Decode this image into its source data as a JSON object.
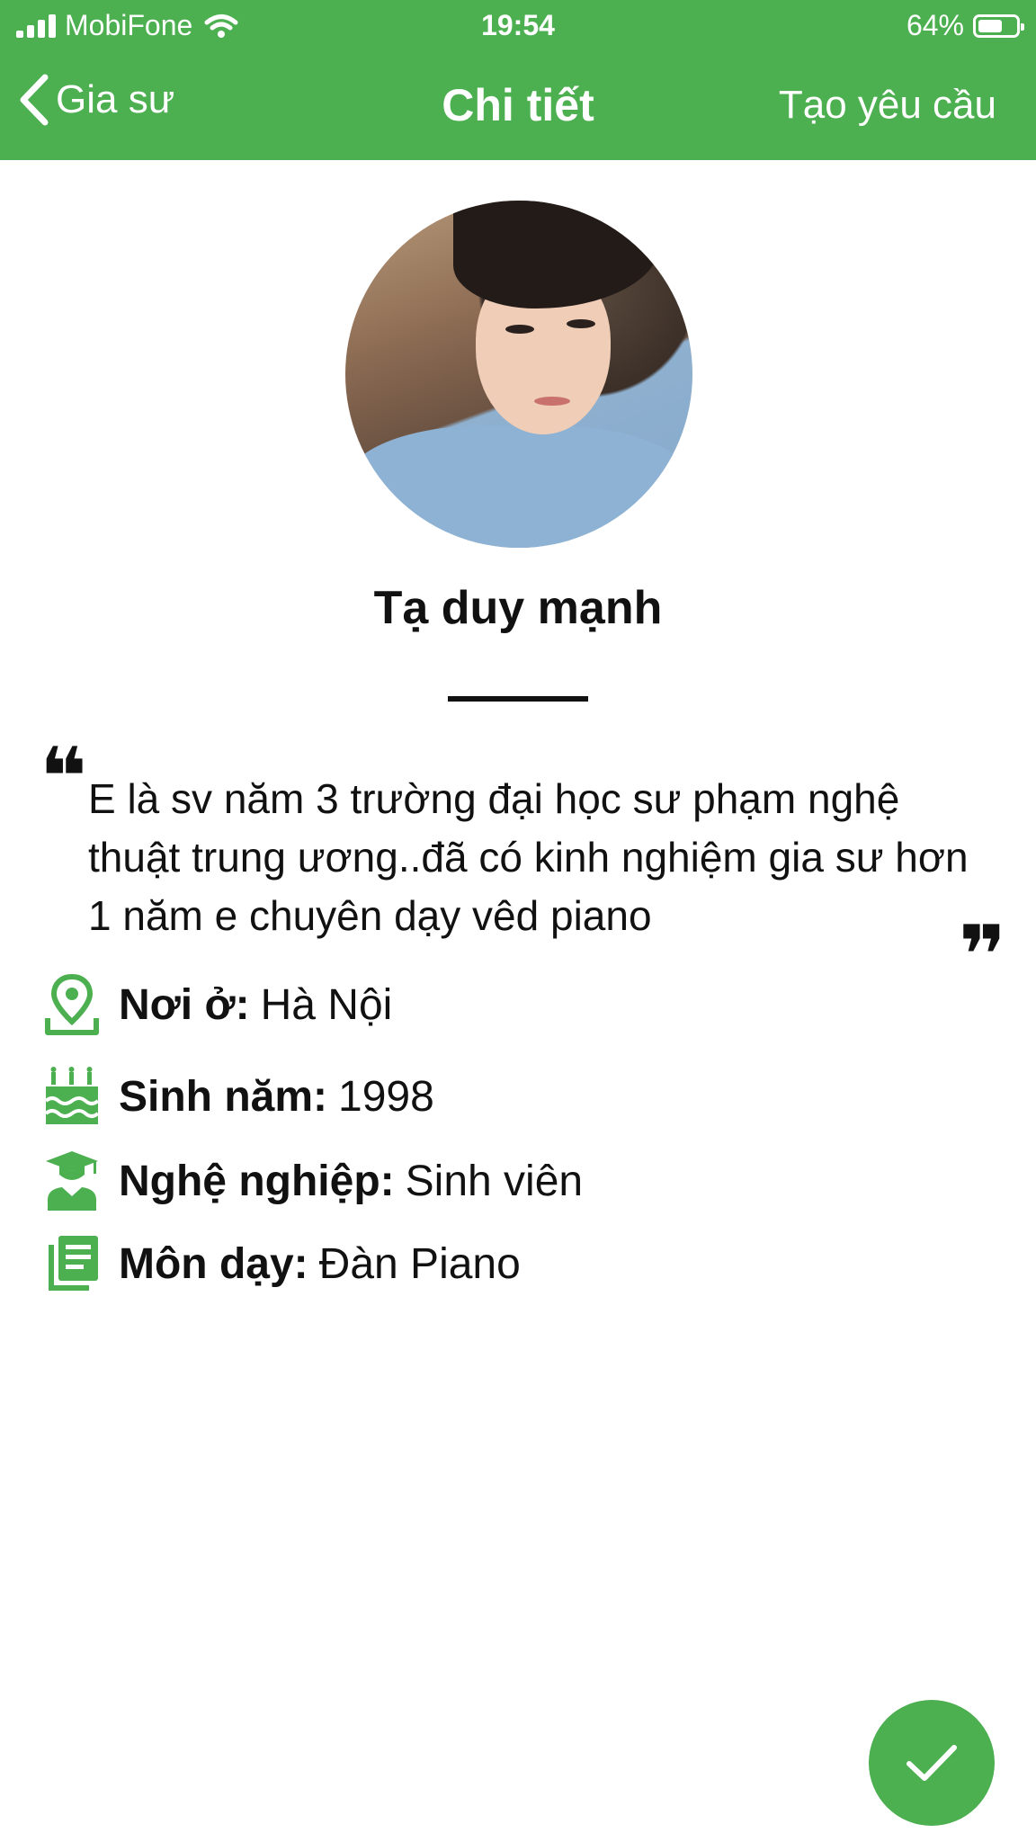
{
  "status_bar": {
    "carrier": "MobiFone",
    "time": "19:54",
    "battery_text": "64%",
    "battery_level": 0.64
  },
  "nav": {
    "back_label": "Gia sư",
    "title": "Chi tiết",
    "action_label": "Tạo yêu cầu"
  },
  "profile": {
    "name": "Tạ duy mạnh",
    "bio": "E là sv năm 3 trường đại học sư phạm nghệ thuật trung ương..đã có kinh nghiệm gia sư hơn 1 năm e chuyên dạy vêd piano",
    "quote_open": "❝",
    "quote_close": "❞"
  },
  "info": [
    {
      "icon": "location-icon",
      "label": "Nơi ở:",
      "value": "Hà Nội"
    },
    {
      "icon": "birthday-cake-icon",
      "label": "Sinh năm:",
      "value": "1998"
    },
    {
      "icon": "graduate-icon",
      "label": "Nghệ nghiệp:",
      "value": "Sinh viên"
    },
    {
      "icon": "book-icon",
      "label": "Môn dạy:",
      "value": "Đàn Piano"
    }
  ],
  "colors": {
    "primary": "#4caf50",
    "text": "#111111",
    "background": "#ffffff"
  }
}
